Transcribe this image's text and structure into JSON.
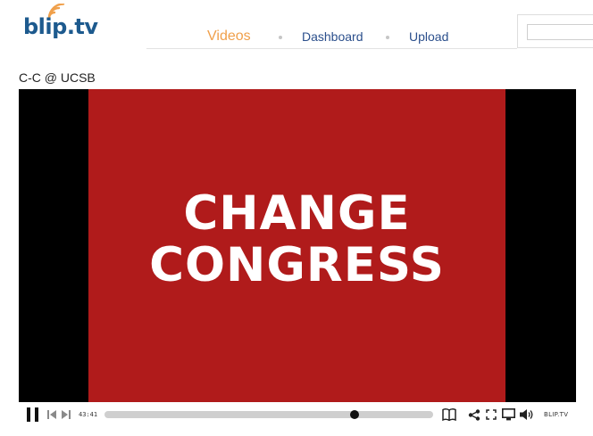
{
  "logo": {
    "text": "blip.tv",
    "icon": "signal-waves-icon",
    "colors": {
      "text": "#1d5a8e",
      "waves": "#f0a04b"
    }
  },
  "nav": {
    "items": [
      {
        "label": "Videos",
        "active": true
      },
      {
        "label": "Dashboard",
        "active": false
      },
      {
        "label": "Upload",
        "active": false
      }
    ],
    "colors": {
      "active": "#f0a04b",
      "link": "#2b4f8c"
    }
  },
  "search": {
    "value": "",
    "placeholder": ""
  },
  "video": {
    "title": "C-C @ UCSB",
    "frame_text": [
      "CHANGE",
      "CONGRESS"
    ],
    "frame_color": "#b01b1b"
  },
  "player": {
    "time": "43:41",
    "progress": 0.76,
    "brand": "BLIP.TV",
    "icons": [
      "pause-icon",
      "previous-icon",
      "next-icon",
      "book-icon",
      "share-icon",
      "expand-icon",
      "screen-icon",
      "volume-icon"
    ]
  }
}
